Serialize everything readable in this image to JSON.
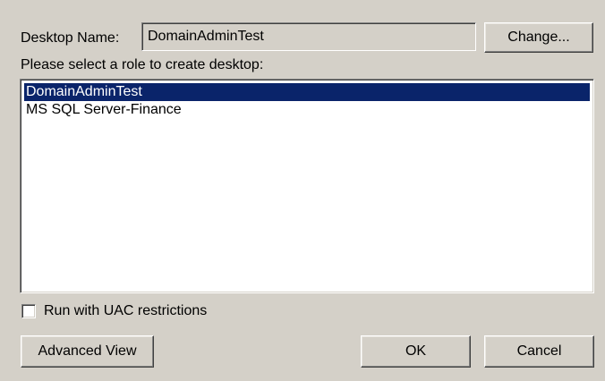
{
  "desktop_name": {
    "label": "Desktop Name:",
    "value": "DomainAdminTest",
    "change_button": "Change..."
  },
  "role_prompt": "Please select a role to create desktop:",
  "roles": [
    {
      "label": "DomainAdminTest",
      "selected": true
    },
    {
      "label": "MS SQL Server-Finance",
      "selected": false
    }
  ],
  "uac": {
    "label": "Run with UAC restrictions",
    "checked": false
  },
  "buttons": {
    "advanced": "Advanced View",
    "ok": "OK",
    "cancel": "Cancel"
  },
  "colors": {
    "dialog_bg": "#d4d0c8",
    "selection_bg": "#0a246a",
    "selection_text": "#ffffff"
  }
}
